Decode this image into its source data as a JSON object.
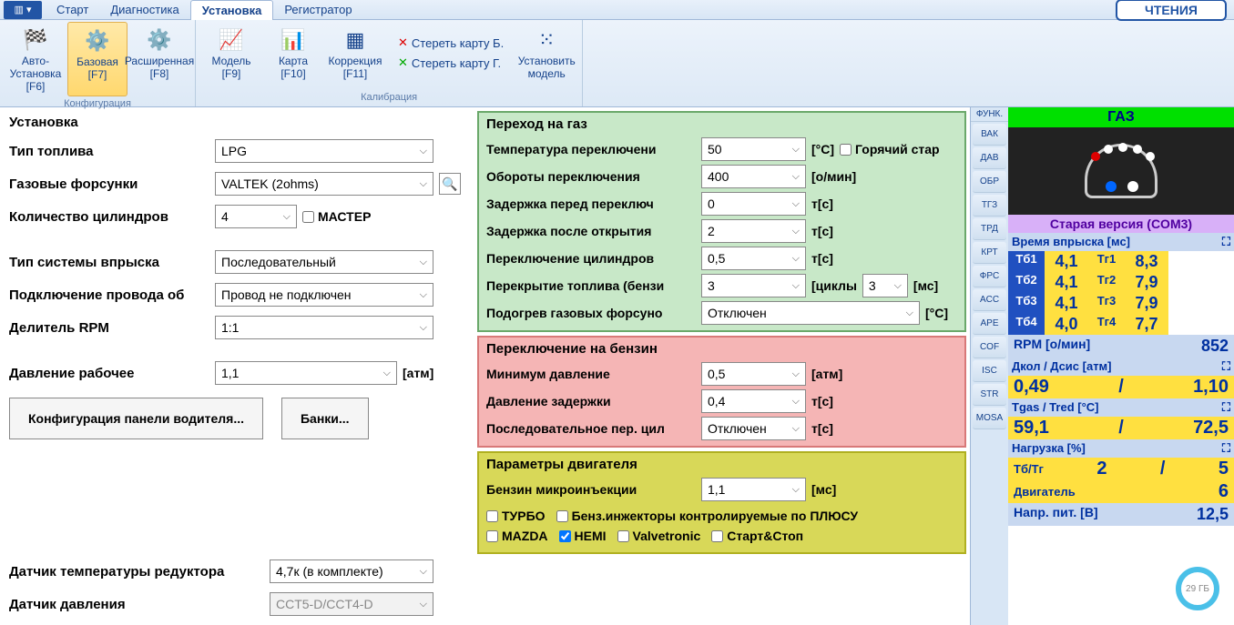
{
  "ribbon": {
    "tabs": [
      "Старт",
      "Диагностика",
      "Установка",
      "Регистратор"
    ],
    "active_tab": "Установка",
    "reading_btn": "ЧТЕНИЯ",
    "group_config": "Конфигурация",
    "group_calib": "Калибрация",
    "items": {
      "auto": {
        "label": "Авто-Установка",
        "hotkey": "[F6]"
      },
      "basic": {
        "label": "Базовая",
        "hotkey": "[F7]"
      },
      "ext": {
        "label": "Расширенная",
        "hotkey": "[F8]"
      },
      "model": {
        "label": "Модель",
        "hotkey": "[F9]"
      },
      "map": {
        "label": "Карта",
        "hotkey": "[F10]"
      },
      "corr": {
        "label": "Коррекция",
        "hotkey": "[F11]"
      }
    },
    "links": {
      "erase_b": "Стереть карту Б.",
      "erase_g": "Стереть карту Г."
    },
    "set_model": "Установить модель"
  },
  "left": {
    "title": "Установка",
    "fuel_type": {
      "label": "Тип топлива",
      "value": "LPG"
    },
    "injectors": {
      "label": "Газовые форсунки",
      "value": "VALTEK (2ohms)"
    },
    "cylinders": {
      "label": "Количество цилиндров",
      "value": "4",
      "master": "МАСТЕР"
    },
    "inj_sys": {
      "label": "Тип системы впрыска",
      "value": "Последовательный"
    },
    "wire": {
      "label": "Подключение провода об",
      "value": "Провод не подключен"
    },
    "rpm_div": {
      "label": "Делитель RPM",
      "value": "1:1"
    },
    "work_press": {
      "label": "Давление рабочее",
      "value": "1,1",
      "unit": "[атм]"
    },
    "btn_panel": "Конфигурация панели водителя...",
    "btn_banks": "Банки...",
    "temp_sensor": {
      "label": "Датчик температуры редуктора",
      "value": "4,7к (в комплекте)"
    },
    "press_sensor": {
      "label": "Датчик давления",
      "value": "CCT5-D/CCT4-D"
    }
  },
  "gas": {
    "title": "Переход на газ",
    "rows": {
      "temp": {
        "label": "Температура переключени",
        "value": "50",
        "unit": "[°C]",
        "cbx": "Горячий стар"
      },
      "rpm": {
        "label": "Обороты переключения",
        "value": "400",
        "unit": "[о/мин]"
      },
      "dbefore": {
        "label": "Задержка перед переключ",
        "value": "0",
        "unit": "т[c]"
      },
      "dafter": {
        "label": "Задержка после открытия",
        "value": "2",
        "unit": "т[c]"
      },
      "cyl": {
        "label": "Переключение цилиндров",
        "value": "0,5",
        "unit": "т[c]"
      },
      "overlap": {
        "label": "Перекрытие топлива (бензи",
        "value": "3",
        "unit": "[циклы",
        "value2": "3",
        "unit2": "[мс]"
      },
      "heat": {
        "label": "Подогрев газовых форсуно",
        "value": "Отключен",
        "unit": "[°C]"
      }
    }
  },
  "petrol": {
    "title": "Переключение на бензин",
    "rows": {
      "minp": {
        "label": "Минимум давление",
        "value": "0,5",
        "unit": "[атм]"
      },
      "dpress": {
        "label": "Давление задержки",
        "value": "0,4",
        "unit": "т[c]"
      },
      "seq": {
        "label": "Последовательное пер. цил",
        "value": "Отключен",
        "unit": "т[c]"
      }
    }
  },
  "engine": {
    "title": "Параметры двигателя",
    "micro": {
      "label": "Бензин микроинъекции",
      "value": "1,1",
      "unit": "[мс]"
    },
    "checks": {
      "turbo": "ТУРБО",
      "plus": "Бенз.инжекторы контролируемые по ПЛЮСУ",
      "mazda": "MAZDA",
      "hemi": "HEMI",
      "valve": "Valvetronic",
      "ss": "Старт&Стоп"
    }
  },
  "side_tabs": {
    "label": "ФУНК.",
    "items": [
      "ВАК",
      "ДАВ",
      "ОБР",
      "ТГЗ",
      "ТРД",
      "КРТ",
      "ФРС",
      "ACC",
      "APE",
      "COF",
      "ISC",
      "STR",
      "MOSA"
    ]
  },
  "status": {
    "gas": "ГАЗ",
    "version": "Старая версия (COM3)",
    "inj_time": "Время впрыска [мс]",
    "rows": [
      {
        "l1": "Тб1",
        "v1": "4,1",
        "l2": "Тг1",
        "v2": "8,3"
      },
      {
        "l1": "Тб2",
        "v1": "4,1",
        "l2": "Тг2",
        "v2": "7,9"
      },
      {
        "l1": "Тб3",
        "v1": "4,1",
        "l2": "Тг3",
        "v2": "7,9"
      },
      {
        "l1": "Тб4",
        "v1": "4,0",
        "l2": "Тг4",
        "v2": "7,7"
      }
    ],
    "rpm": {
      "label": "RPM [о/мин]",
      "value": "852"
    },
    "press": {
      "label": "Дкол / Дсис [атм]",
      "v1": "0,49",
      "sep": "/",
      "v2": "1,10"
    },
    "tgas": {
      "label": "Tgas / Tred [°C]",
      "v1": "59,1",
      "sep": "/",
      "v2": "72,5"
    },
    "load": {
      "label": "Нагрузка [%]"
    },
    "tbtg": {
      "label": "Тб/Тг",
      "v1": "2",
      "sep": "/",
      "v2": "5"
    },
    "eng": {
      "label": "Двигатель",
      "v": "6"
    },
    "volt": {
      "label": "Напр. пит. [В]",
      "v": "12,5"
    }
  },
  "badge": "29 ГБ"
}
